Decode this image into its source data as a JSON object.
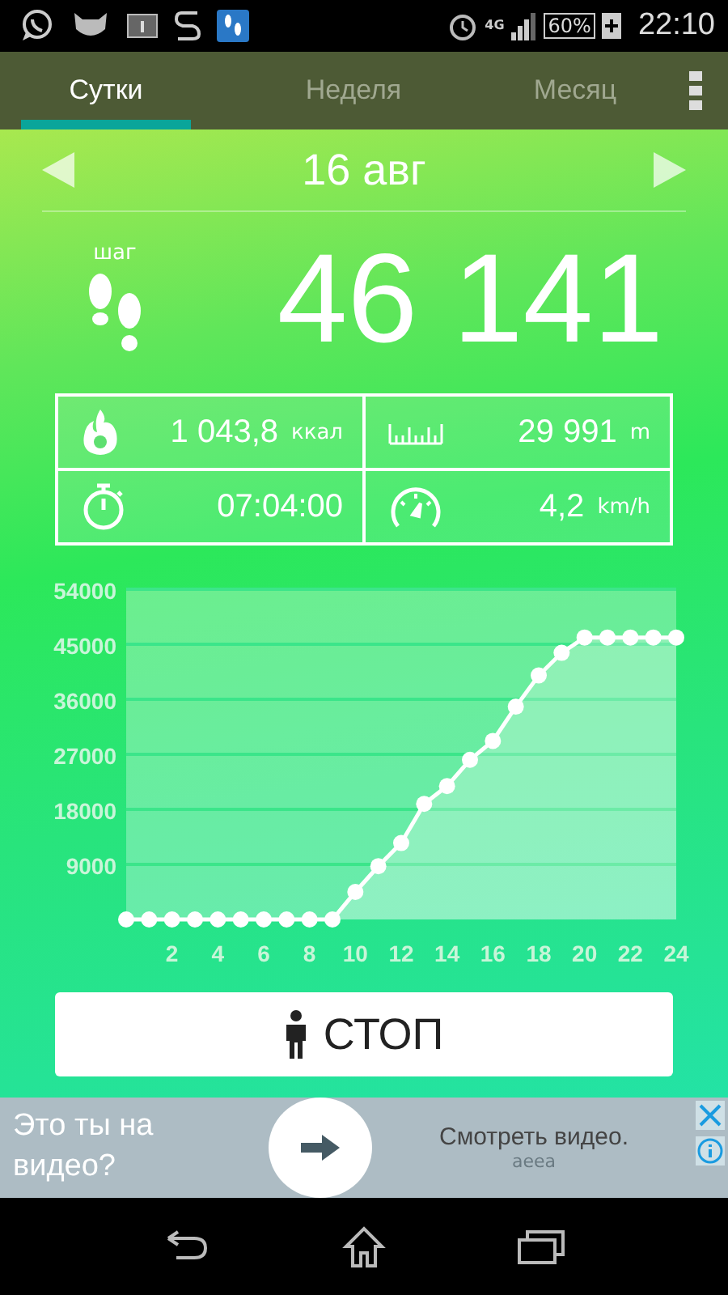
{
  "status_bar": {
    "network": "4G",
    "battery": "60%",
    "time": "22:10"
  },
  "tabs": [
    {
      "label": "Сутки",
      "selected": true
    },
    {
      "label": "Неделя",
      "selected": false
    },
    {
      "label": "Месяц",
      "selected": false
    }
  ],
  "date": "16 авг",
  "steps_label": "шаг",
  "steps": "46 141",
  "stats": [
    {
      "kind": "calories",
      "value": "1 043,8",
      "unit": "ккал"
    },
    {
      "kind": "distance",
      "value": "29 991",
      "unit": "m"
    },
    {
      "kind": "duration",
      "value": "07:04:00"
    },
    {
      "kind": "speed",
      "value": "4,2",
      "unit": "km/h"
    }
  ],
  "chart": {
    "chart_data": {
      "type": "area",
      "x": [
        0,
        1,
        2,
        3,
        4,
        5,
        6,
        7,
        8,
        9,
        10,
        11,
        12,
        13,
        14,
        15,
        16,
        17,
        18,
        19,
        20,
        21,
        22,
        23,
        24
      ],
      "series": [
        {
          "color": "#ffffff",
          "values": [
            0,
            0,
            0,
            0,
            0,
            0,
            0,
            0,
            0,
            0,
            4500,
            8700,
            12500,
            18900,
            21800,
            26100,
            29200,
            34800,
            39900,
            43600,
            46100,
            46100,
            46100,
            46100,
            46100
          ]
        }
      ],
      "grid": true,
      "xlim": [
        0,
        24
      ],
      "ylim": [
        0,
        54000
      ],
      "xticks": [
        2,
        4,
        6,
        8,
        10,
        12,
        14,
        16,
        18,
        20,
        22,
        24
      ],
      "yticks": [
        9000,
        18000,
        27000,
        36000,
        45000,
        54000
      ]
    }
  },
  "stop_button": "СТОП",
  "ad": {
    "headline": "Это ты на видео?",
    "cta": "Смотреть видео.",
    "source": "aeea"
  }
}
